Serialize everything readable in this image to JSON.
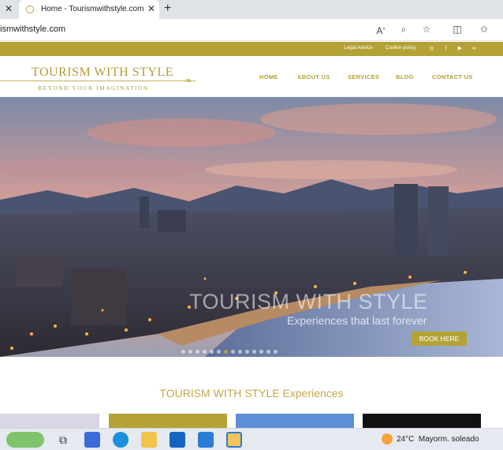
{
  "browser": {
    "tab_title": "Home - Tourismwithstyle.com",
    "url": "ismwithstyle.com",
    "icons": [
      "read-aloud-icon",
      "zoom-icon",
      "favorite-star-icon",
      "split-screen-icon",
      "favorites-icon"
    ]
  },
  "site": {
    "top_links": [
      "Legal Advice",
      "Cookie policy"
    ],
    "social_icons": [
      "instagram-icon",
      "facebook-icon",
      "youtube-icon",
      "tripadvisor-icon"
    ],
    "logo_main": "TOURISM WITH STYLE",
    "logo_sub": "BEYOND YOUR IMAGINATION",
    "nav": [
      "HOME",
      "ABOUT US",
      "SERVICES",
      "BLOG",
      "CONTACT US"
    ],
    "accent_color": "#b5a236",
    "hero": {
      "title": "TOURISM WITH STYLE",
      "subtitle": "Experiences that last forever",
      "button": "BOOK HERE",
      "slide_count": 14,
      "active_slide": 6
    },
    "section_title": "TOURISM WITH STYLE Experiences"
  },
  "taskbar": {
    "apps": [
      "tennis-widget-icon",
      "task-view-icon",
      "store-icon",
      "edge-icon",
      "file-explorer-icon",
      "outlook-icon",
      "mail-icon",
      "photos-icon"
    ],
    "weather_temp": "24°C",
    "weather_desc": "Mayorm. soleado"
  }
}
